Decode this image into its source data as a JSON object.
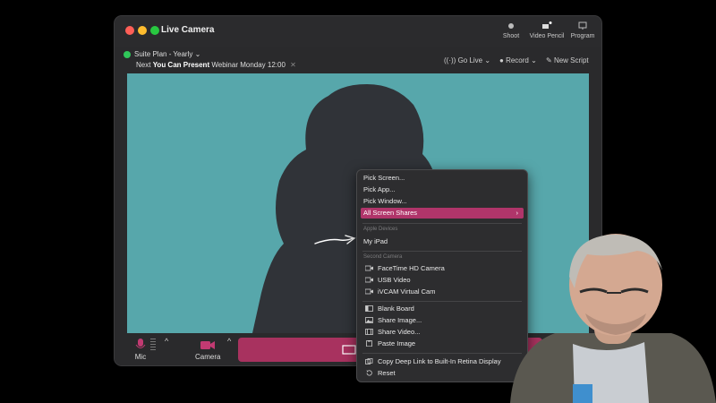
{
  "window": {
    "title": "Live Camera",
    "toolbar": [
      {
        "label": "Shoot",
        "icon": "camera-icon"
      },
      {
        "label": "Video Pencil",
        "icon": "video-pencil-icon"
      },
      {
        "label": "Program",
        "icon": "program-monitor-icon"
      }
    ]
  },
  "subbar": {
    "plan_label": "Suite Plan - Yearly",
    "next_prefix": "Next",
    "next_title": "You Can Present",
    "next_suffix": "Webinar Monday 12:00",
    "go_live": "Go Live",
    "record": "Record",
    "new_script": "New Script"
  },
  "bottombar": {
    "mic_label": "Mic",
    "camera_label": "Camera"
  },
  "context_menu": {
    "items_top": [
      "Pick Screen...",
      "Pick App...",
      "Pick Window...",
      "All Screen Shares"
    ],
    "apple_devices_header": "Apple Devices",
    "apple_devices": [
      "My iPad"
    ],
    "second_camera_header": "Second Camera",
    "second_camera": [
      "FaceTime HD Camera",
      "USB Video",
      "iVCAM Virtual Cam"
    ],
    "media_items": [
      "Blank Board",
      "Share Image...",
      "Share Video...",
      "Paste Image"
    ],
    "footer_items": [
      "Copy Deep Link to Built-In Retina Display",
      "Reset"
    ],
    "selected": "All Screen Shares"
  },
  "colors": {
    "accent": "#b0356a",
    "stage": "#57a7ab",
    "silhouette": "#303338",
    "status_green": "#30c75a"
  }
}
